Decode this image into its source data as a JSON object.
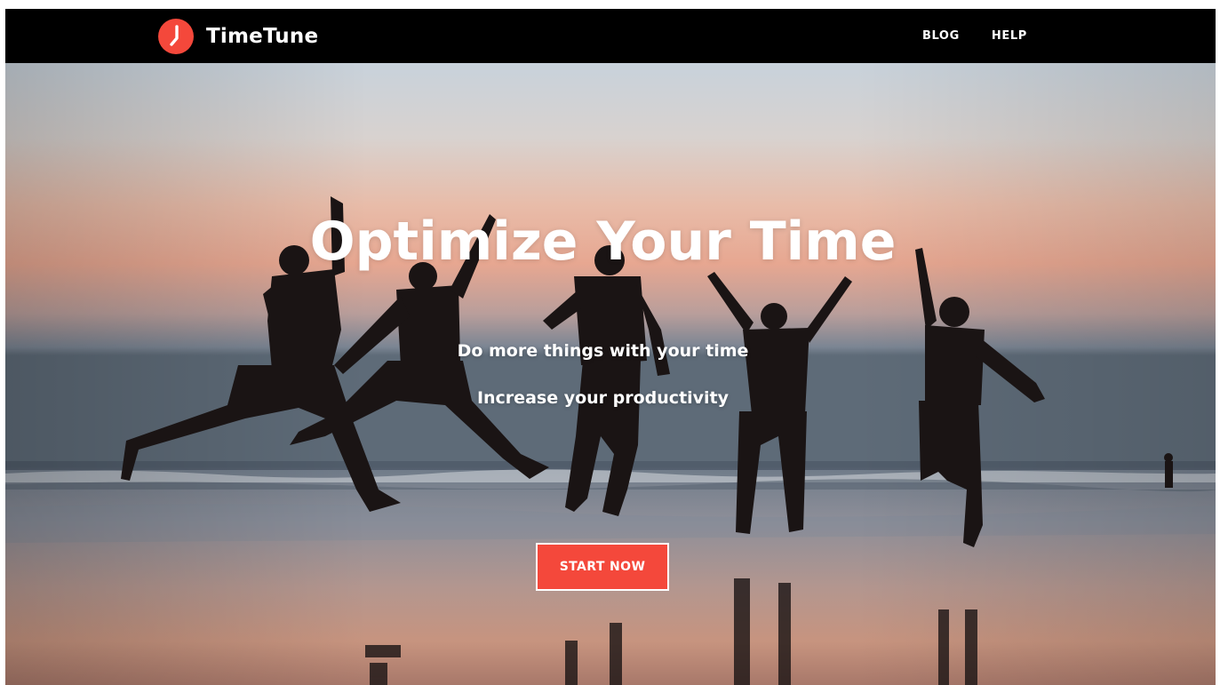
{
  "brand": {
    "name": "TimeTune",
    "logo_icon": "clock-icon",
    "accent_color": "#f4483b"
  },
  "nav": {
    "links": [
      {
        "label": "BLOG"
      },
      {
        "label": "HELP"
      }
    ]
  },
  "hero": {
    "title": "Optimize Your Time",
    "line1": "Do more things with your time",
    "line2": "Increase your productivity",
    "cta_label": "START NOW",
    "background": "beach-sunset-jumping-people-photo"
  },
  "colors": {
    "navbar": "#000000",
    "cta_background": "#f4483b",
    "text": "#ffffff"
  }
}
